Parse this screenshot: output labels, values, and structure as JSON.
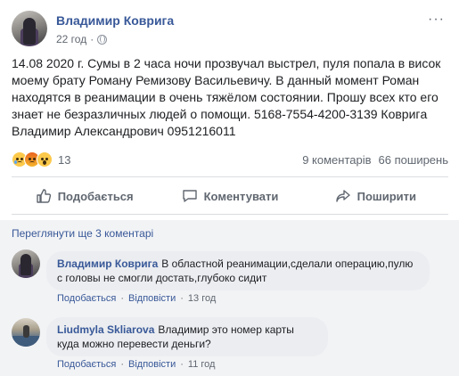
{
  "post": {
    "author": "Владимир Ковригa",
    "time": "22 год",
    "more_label": "···",
    "text": "14.08 2020 г. Сумы в 2 часа ночи прозвучал выстрел, пуля попала в висок моему брату Роману Ремизову Васильевичу. В данный момент Роман находятся в реанимации в очень тяжёлом состоянии. Прошу всех кто его знает не безразличных людей о помощи. 5168-7554-4200-3139 Ковригa Владимир Александрович 0951216011",
    "reactions": {
      "icons": [
        "sad-reaction-icon",
        "angry-reaction-icon",
        "wow-reaction-icon"
      ],
      "count": "13"
    },
    "comments_count": "9 коментарів",
    "shares_count": "66 поширень"
  },
  "actions": {
    "like": "Подобається",
    "comment": "Коментувати",
    "share": "Поширити"
  },
  "comments_section": {
    "view_more": "Переглянути ще 3 коментарі",
    "comments": [
      {
        "author": "Владимир Ковригa",
        "text": "В областной реанимации,сделали операцию,пулю с головы не смогли достать,глубоко сидит",
        "like": "Подобається",
        "reply": "Відповісти",
        "time": "13 год"
      },
      {
        "author": "Liudmyla Skliarova",
        "text": "Владимир это номер карты куда можно перевести деньги?",
        "like": "Подобається",
        "reply": "Відповісти",
        "time": "11 год"
      }
    ]
  },
  "colors": {
    "link": "#385898",
    "secondary_text": "#606770",
    "comments_bg": "#f2f3f5",
    "bubble_bg": "#ebedf0"
  }
}
